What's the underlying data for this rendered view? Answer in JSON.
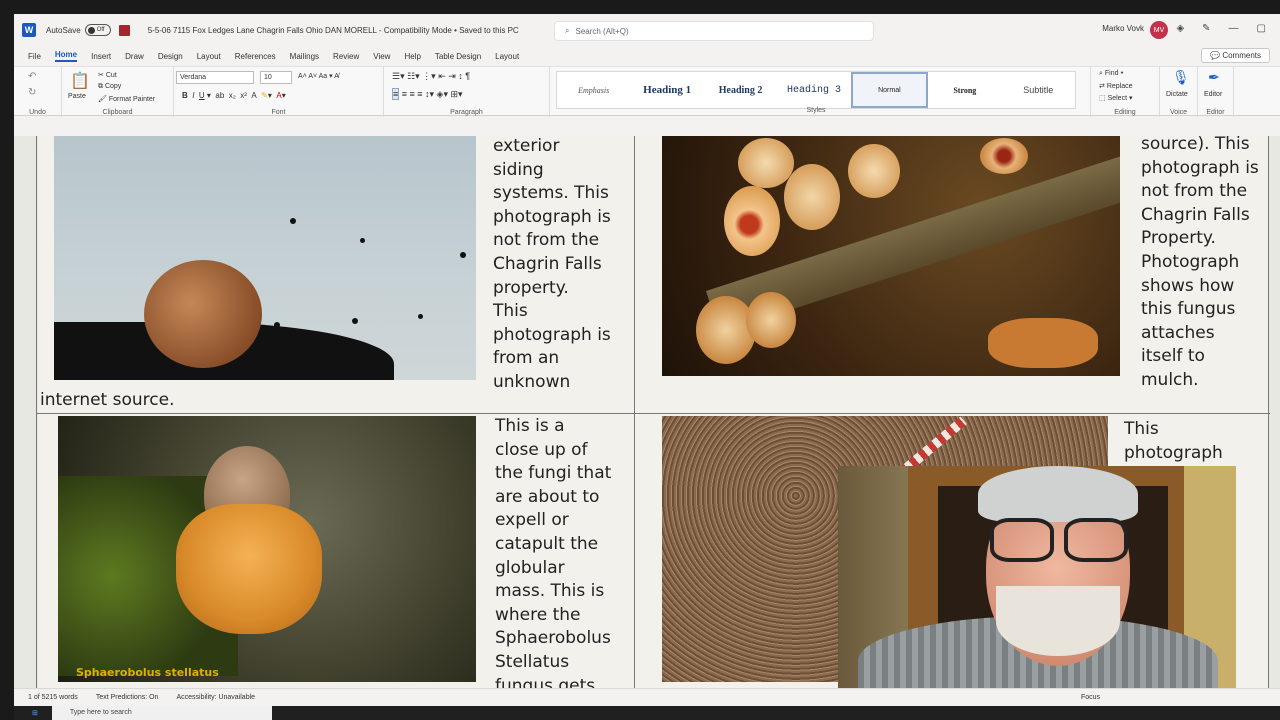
{
  "titlebar": {
    "autosave_label": "AutoSave",
    "autosave_state": "Off",
    "doc_title": "5-5-06 7115 Fox Ledges Lane Chagrin Falls Ohio  DAN MORELL  -  Compatibility Mode • Saved to this PC",
    "search_placeholder": "Search (Alt+Q)",
    "user_name": "Marko Vovk",
    "user_initials": "MV"
  },
  "menu": {
    "tabs": [
      "File",
      "Home",
      "Insert",
      "Draw",
      "Design",
      "Layout",
      "References",
      "Mailings",
      "Review",
      "View",
      "Help",
      "Table Design",
      "Layout"
    ],
    "comments_label": "Comments"
  },
  "ribbon": {
    "undo_label": "Undo",
    "clipboard": {
      "paste": "Paste",
      "cut": "Cut",
      "copy": "Copy",
      "format_painter": "Format Painter",
      "label": "Clipboard"
    },
    "font": {
      "name": "Verdana",
      "size": "10",
      "label": "Font"
    },
    "paragraph_label": "Paragraph",
    "styles": {
      "label": "Styles",
      "items": [
        "Emphasis",
        "Heading 1",
        "Heading 2",
        "Heading 3",
        "Normal",
        "Strong",
        "Subtitle"
      ],
      "selected": "Normal"
    },
    "editing": {
      "find": "Find",
      "replace": "Replace",
      "select": "Select",
      "label": "Editing"
    },
    "voice": {
      "dictate": "Dictate",
      "label": "Voice"
    },
    "editor": {
      "button": "Editor",
      "label": "Editor"
    }
  },
  "document": {
    "text_top_left": "exterior\nsiding\nsystems. This\nphotograph is\nnot from the\nChagrin Falls\nproperty.\nThis\nphotograph is\nfrom an\nunknown",
    "text_internet_source": "internet source.",
    "text_top_right": "source). This\nphotograph is\nnot from the\nChagrin Falls\nProperty.\nPhotograph\nshows how\nthis fungus\nattaches\nitself to\nmulch.",
    "text_bottom_left": "This is a\nclose up of\nthe fungi that\nare about to\nexpell or\ncatapult the\nglobular\nmass. This is\nwhere the\nSphaerobolus\nStellatus\nfungus gets",
    "text_bottom_right": "This\nphotograph",
    "caption_fungus": "Sphaerobolus stellatus"
  },
  "statusbar": {
    "word_count": "1 of 5215 words",
    "text_predictions": "Text Predictions: On",
    "accessibility": "Accessibility: Unavailable",
    "focus": "Focus"
  },
  "taskbar": {
    "search_placeholder": "Type here to search"
  }
}
